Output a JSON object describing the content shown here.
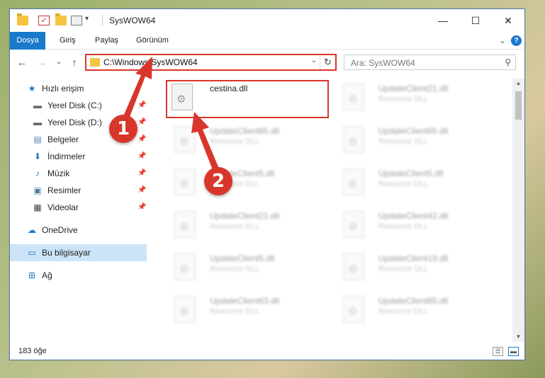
{
  "window": {
    "title": "SysWOW64",
    "controls": {
      "minimize": "—",
      "maximize": "☐",
      "close": "✕"
    }
  },
  "ribbon": {
    "tabs": [
      {
        "label": "Dosya",
        "active": true
      },
      {
        "label": "Giriş"
      },
      {
        "label": "Paylaş"
      },
      {
        "label": "Görünüm"
      }
    ],
    "expand": "⌄",
    "help": "?"
  },
  "nav": {
    "back": "←",
    "forward": "→",
    "recent": "⌄",
    "up": "↑",
    "address": "C:\\Windows\\SysWOW64",
    "refresh": "↻",
    "search_placeholder": "Ara: SysWOW64"
  },
  "sidebar": {
    "items": [
      {
        "label": "Hızlı erişim",
        "icon": "star-icon"
      },
      {
        "label": "Yerel Disk (C:)",
        "icon": "drive-icon",
        "pinned": true
      },
      {
        "label": "Yerel Disk (D:)",
        "icon": "drive-icon",
        "pinned": true
      },
      {
        "label": "Belgeler",
        "icon": "documents-icon",
        "pinned": true
      },
      {
        "label": "İndirmeler",
        "icon": "download-icon",
        "pinned": true
      },
      {
        "label": "Müzik",
        "icon": "music-icon",
        "pinned": true
      },
      {
        "label": "Resimler",
        "icon": "pictures-icon",
        "pinned": true
      },
      {
        "label": "Videolar",
        "icon": "video-icon",
        "pinned": true
      },
      {
        "label": "OneDrive",
        "icon": "cloud-icon"
      },
      {
        "label": "Bu bilgisayar",
        "icon": "computer-icon",
        "selected": true
      },
      {
        "label": "Ağ",
        "icon": "network-icon"
      }
    ]
  },
  "files": [
    {
      "name": "cestina.dll",
      "desc": "",
      "highlight": true
    },
    {
      "name": "UpdateClient21.dll",
      "desc": "Resource DLL"
    },
    {
      "name": "UpdateClient65.dll",
      "desc": "Resource DLL"
    },
    {
      "name": "UpdateClient65.dll",
      "desc": "Resource DLL"
    },
    {
      "name": "UpdateClient5.dll",
      "desc": "Resource DLL"
    },
    {
      "name": "UpdateClient5.dll",
      "desc": "Resource DLL"
    },
    {
      "name": "UpdateClient21.dll",
      "desc": "Resource DLL"
    },
    {
      "name": "UpdateClient42.dll",
      "desc": "Resource DLL"
    },
    {
      "name": "UpdateClient5.dll",
      "desc": "Resource DLL"
    },
    {
      "name": "UpdateClient19.dll",
      "desc": "Resource DLL"
    },
    {
      "name": "UpdateClient63.dll",
      "desc": "Resource DLL"
    },
    {
      "name": "UpdateClient65.dll",
      "desc": "Resource DLL"
    }
  ],
  "status": {
    "count": "183 öğe"
  },
  "callouts": [
    {
      "label": "1"
    },
    {
      "label": "2"
    }
  ],
  "colors": {
    "accent": "#1979ca",
    "callout": "#d9362b",
    "selected": "#cce4f7"
  }
}
